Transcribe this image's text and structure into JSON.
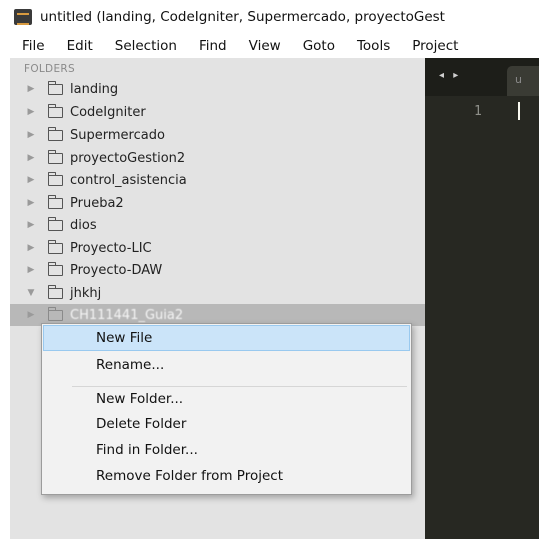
{
  "window": {
    "title": "untitled (landing, CodeIgniter, Supermercado, proyectoGest"
  },
  "menubar": {
    "items": [
      "File",
      "Edit",
      "Selection",
      "Find",
      "View",
      "Goto",
      "Tools",
      "Project"
    ]
  },
  "sidebar": {
    "header": "FOLDERS",
    "folders": [
      {
        "label": "landing",
        "expanded": false
      },
      {
        "label": "CodeIgniter",
        "expanded": false
      },
      {
        "label": "Supermercado",
        "expanded": false
      },
      {
        "label": "proyectoGestion2",
        "expanded": false
      },
      {
        "label": "control_asistencia",
        "expanded": false
      },
      {
        "label": "Prueba2",
        "expanded": false
      },
      {
        "label": "dios",
        "expanded": false
      },
      {
        "label": "Proyecto-LIC",
        "expanded": false
      },
      {
        "label": "Proyecto-DAW",
        "expanded": false
      },
      {
        "label": "jhkhj",
        "expanded": true
      },
      {
        "label": "CH111441_Guia2",
        "expanded": false,
        "selected": true
      }
    ]
  },
  "editor": {
    "tab_nav": "◂ ▸",
    "tab_label": "u",
    "line_number": "1",
    "background": "#272822"
  },
  "context_menu": {
    "items": [
      {
        "label": "New File",
        "highlighted": true
      },
      {
        "label": "Rename..."
      },
      {
        "label": "New Folder..."
      },
      {
        "label": "Delete Folder"
      },
      {
        "label": "Find in Folder..."
      },
      {
        "label": "Remove Folder from Project"
      }
    ],
    "highlight_color": "#cbe4f9"
  }
}
